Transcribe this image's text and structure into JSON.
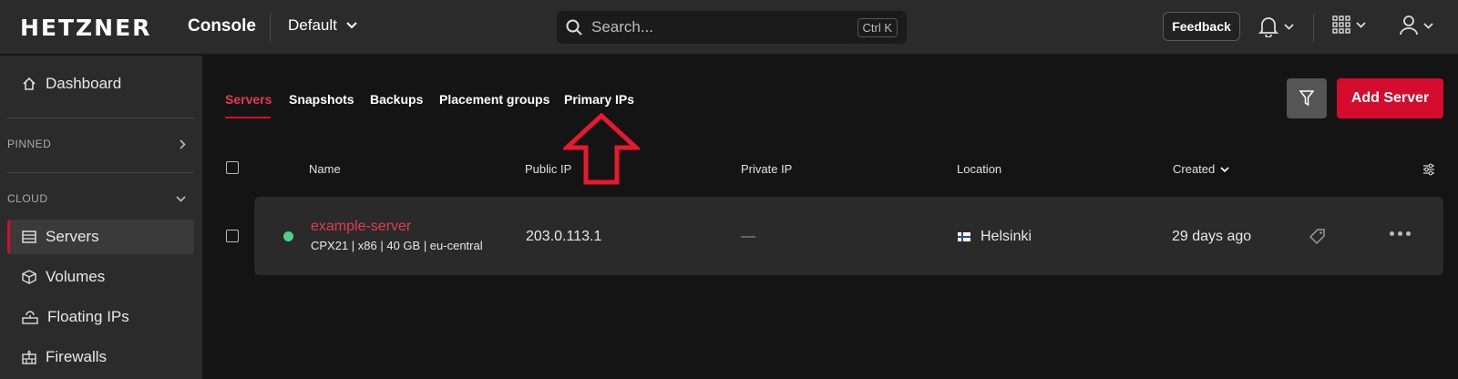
{
  "header": {
    "brand": "HETZNER",
    "product": "Console",
    "project": "Default",
    "search_placeholder": "Search...",
    "search_shortcut": "Ctrl K",
    "feedback_label": "Feedback"
  },
  "sidebar": {
    "dashboard": "Dashboard",
    "pinned": "PINNED",
    "cloud": "CLOUD",
    "items": [
      "Servers",
      "Volumes",
      "Floating IPs",
      "Firewalls"
    ]
  },
  "tabs": [
    "Servers",
    "Snapshots",
    "Backups",
    "Placement groups",
    "Primary IPs"
  ],
  "actions": {
    "add_server": "Add Server"
  },
  "table": {
    "columns": [
      "Name",
      "Public IP",
      "Private IP",
      "Location",
      "Created"
    ],
    "rows": [
      {
        "name": "example-server",
        "spec": "CPX21 | x86 | 40 GB | eu-central",
        "public_ip": "203.0.113.1",
        "private_ip": "—",
        "location": "Helsinki",
        "created": "29 days ago",
        "status": "running"
      }
    ]
  },
  "colors": {
    "accent": "#d50c2d",
    "status_running": "#4ed08a",
    "annotation_arrow": "#e8192c"
  }
}
